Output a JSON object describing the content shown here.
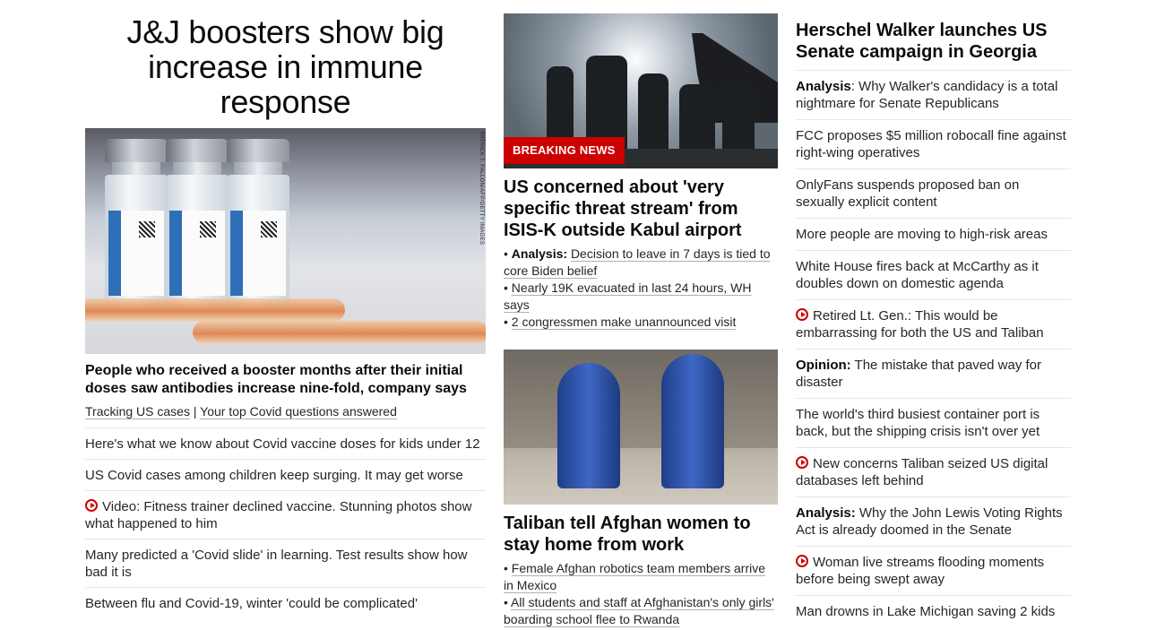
{
  "col1": {
    "headline": "J&J boosters show big increase in immune response",
    "image_credit": "PATRICK T. FALLON/AFP/GETTY IMAGES",
    "subheadline": "People who received a booster months after their initial doses saw antibodies increase nine-fold, company says",
    "link1": "Tracking US cases",
    "separator": "|",
    "link2": "Your top Covid questions answered",
    "items": [
      {
        "text": "Here's what we know about Covid vaccine doses for kids under 12"
      },
      {
        "text": "US Covid cases among children keep surging. It may get worse"
      },
      {
        "text": "Video: Fitness trainer declined vaccine. Stunning photos show what happened to him"
      },
      {
        "text": "Many predicted a 'Covid slide' in learning. Test results show how bad it is"
      },
      {
        "text": "Between flu and Covid-19, winter 'could be complicated'"
      }
    ]
  },
  "col2": {
    "breaking_label": "BREAKING NEWS",
    "story1_headline": "US concerned about 'very specific threat stream' from ISIS-K outside Kabul airport",
    "story1_bullets": [
      {
        "prefix": "Analysis:",
        "text": "Decision to leave in 7 days is tied to core Biden belief"
      },
      {
        "text": "Nearly 19K evacuated in last 24 hours, WH says"
      },
      {
        "text": "2 congressmen make unannounced visit"
      }
    ],
    "story2_headline": "Taliban tell Afghan women to stay home from work",
    "story2_bullets": [
      {
        "text": "Female Afghan robotics team members arrive in Mexico"
      },
      {
        "text": "All students and staff at Afghanistan's only girls' boarding school flee to Rwanda"
      }
    ]
  },
  "col3": {
    "headline": "Herschel Walker launches US Senate campaign in Georgia",
    "items": [
      {
        "prefix": "Analysis",
        "text": ": Why Walker's candidacy is a total nightmare for Senate Republicans"
      },
      {
        "text": "FCC proposes $5 million robocall fine against right-wing operatives"
      },
      {
        "text": "OnlyFans suspends proposed ban on sexually explicit content"
      },
      {
        "text": "More people are moving to high-risk areas"
      },
      {
        "text": "White House fires back at McCarthy as it doubles down on domestic agenda"
      },
      {
        "text": "Retired Lt. Gen.: This would be embarrassing for both the US and Taliban"
      },
      {
        "prefix": "Opinion:",
        "text": " The mistake that paved way for disaster"
      },
      {
        "text": "The world's third busiest container port is back, but the shipping crisis isn't over yet"
      },
      {
        "text": "New concerns Taliban seized US digital databases left behind"
      },
      {
        "prefix": "Analysis:",
        "text": " Why the John Lewis Voting Rights Act is already doomed in the Senate"
      },
      {
        "text": "Woman live streams flooding moments before being swept away"
      },
      {
        "text": "Man drowns in Lake Michigan saving 2 kids"
      }
    ]
  },
  "icons": {
    "video": "play-circle-icon"
  },
  "colors": {
    "breaking": "#cc0000",
    "play_icon": "#cc0000",
    "text": "#0c0c0c",
    "divider": "#e6e6e6"
  }
}
